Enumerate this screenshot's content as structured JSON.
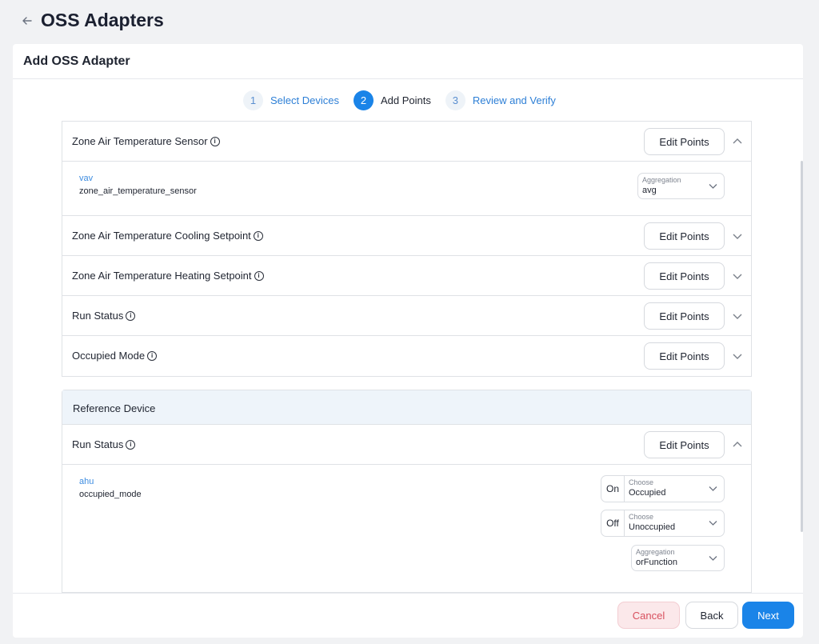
{
  "header": {
    "title": "OSS Adapters"
  },
  "card": {
    "title": "Add OSS Adapter"
  },
  "stepper": [
    {
      "num": "1",
      "label": "Select Devices"
    },
    {
      "num": "2",
      "label": "Add Points"
    },
    {
      "num": "3",
      "label": "Review and Verify"
    }
  ],
  "points": {
    "edit_label": "Edit Points",
    "rows": [
      {
        "label": "Zone Air Temperature Sensor",
        "expanded": true,
        "detail": {
          "device_type": "vav",
          "point": "zone_air_temperature_sensor",
          "aggregation_label": "Aggregation",
          "aggregation_value": "avg"
        }
      },
      {
        "label": "Zone Air Temperature Cooling Setpoint",
        "expanded": false
      },
      {
        "label": "Zone Air Temperature Heating Setpoint",
        "expanded": false
      },
      {
        "label": "Run Status",
        "expanded": false
      },
      {
        "label": "Occupied Mode",
        "expanded": false
      }
    ]
  },
  "reference": {
    "title": "Reference Device",
    "row_label": "Run Status",
    "expanded": true,
    "detail": {
      "device_type": "ahu",
      "point": "occupied_mode",
      "on_label": "On",
      "on_choose_label": "Choose",
      "on_value": "Occupied",
      "off_label": "Off",
      "off_choose_label": "Choose",
      "off_value": "Unoccupied",
      "aggregation_label": "Aggregation",
      "aggregation_value": "orFunction"
    }
  },
  "footer": {
    "cancel": "Cancel",
    "back": "Back",
    "next": "Next"
  },
  "colors": {
    "accent": "#1a84e8",
    "cancel_text": "#d8505e",
    "cancel_bg": "#fbe8ea",
    "reference_header_bg": "#eef4fa"
  },
  "icons": {
    "back": "arrow-left-icon",
    "info": "info-circle-icon",
    "expand": "chevron-down-icon",
    "collapse": "chevron-up-icon"
  }
}
